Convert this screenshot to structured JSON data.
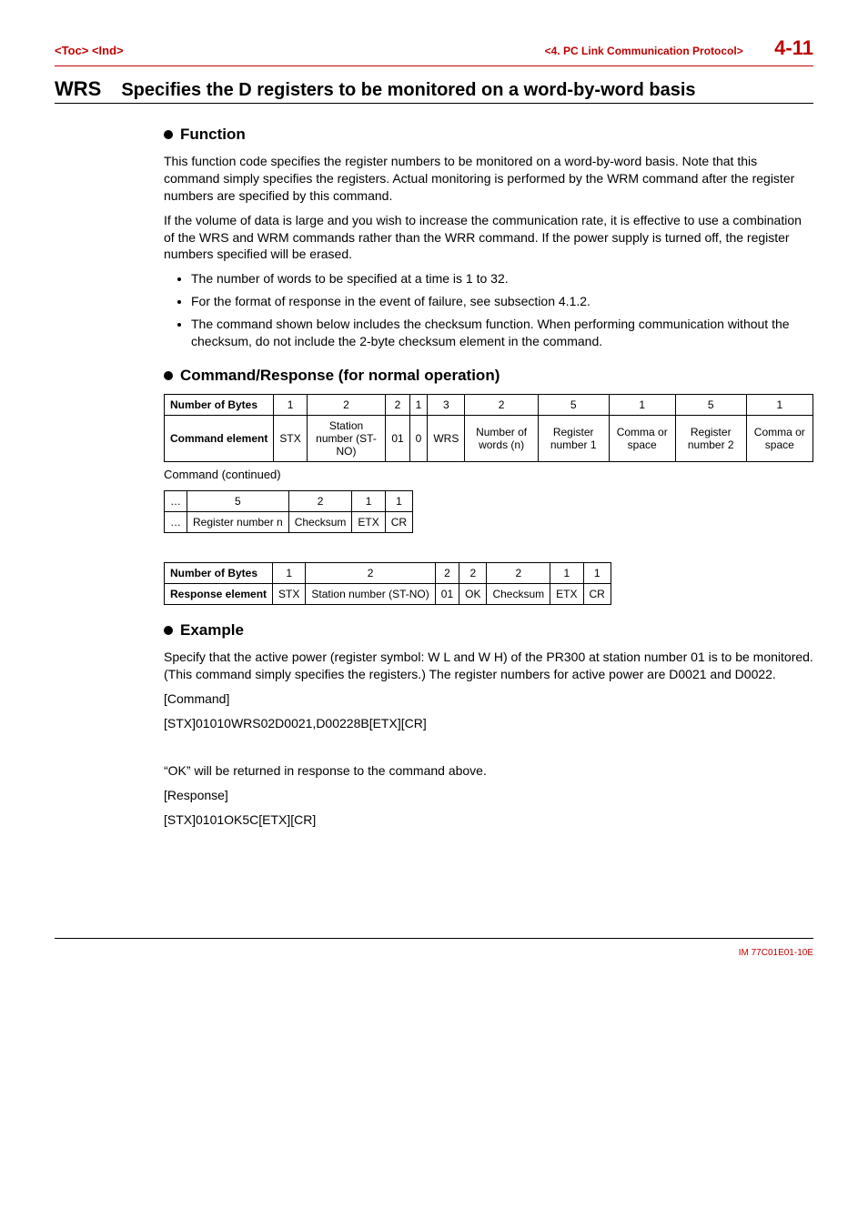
{
  "header": {
    "left": "<Toc> <Ind>",
    "chapter": "<4.  PC Link Communication Protocol>",
    "page": "4-11"
  },
  "section": {
    "code": "WRS",
    "desc": "Specifies the D registers to be monitored on a word-by-word basis"
  },
  "function": {
    "heading": "Function",
    "p1": "This function code specifies the register numbers to be monitored on a word-by-word basis. Note that this command simply specifies the registers. Actual monitoring is performed by the WRM command after the register numbers are specified by this command.",
    "p2": "If the volume of data is large and you wish to increase the communication rate, it is effective to use a combination of the WRS and WRM commands rather than the WRR command. If the power supply is turned off, the register numbers specified will be erased.",
    "bullets": [
      "The number of words to be specified at a time is 1 to 32.",
      "For the format of response in the event of failure, see subsection 4.1.2.",
      "The command shown below includes the checksum function. When performing communication without the checksum, do not include the 2-byte checksum element in the command."
    ]
  },
  "cmd_resp": {
    "heading": "Command/Response (for normal operation)",
    "table1": {
      "bytes_label": "Number of Bytes",
      "cmd_label": "Command element",
      "bytes": [
        "1",
        "2",
        "2",
        "1",
        "3",
        "2",
        "5",
        "1",
        "5",
        "1"
      ],
      "cells": [
        "STX",
        "Station number (ST-NO)",
        "01",
        "0",
        "WRS",
        "Number of words (n)",
        "Register number 1",
        "Comma or space",
        "Register number 2",
        "Comma or space"
      ]
    },
    "cont_label": "Command (continued)",
    "table2": {
      "bytes": [
        "…",
        "5",
        "2",
        "1",
        "1"
      ],
      "cells": [
        "…",
        "Register number n",
        "Checksum",
        "ETX",
        "CR"
      ]
    },
    "table3": {
      "bytes_label": "Number of Bytes",
      "resp_label": "Response element",
      "bytes": [
        "1",
        "2",
        "2",
        "2",
        "2",
        "1",
        "1"
      ],
      "cells": [
        "STX",
        "Station number (ST-NO)",
        "01",
        "OK",
        "Checksum",
        "ETX",
        "CR"
      ]
    }
  },
  "example": {
    "heading": "Example",
    "p1": "Specify that the active power (register symbol: W L and W H) of the PR300 at station number 01 is to be monitored. (This command simply specifies the registers.) The register numbers for active power are D0021 and D0022.",
    "cmd_label": "[Command]",
    "cmd_text": "[STX]01010WRS02D0021,D00228B[ETX][CR]",
    "resp_intro": "“OK” will be returned in response to the command above.",
    "resp_label": "[Response]",
    "resp_text": "[STX]0101OK5C[ETX][CR]"
  },
  "footer": "IM 77C01E01-10E"
}
